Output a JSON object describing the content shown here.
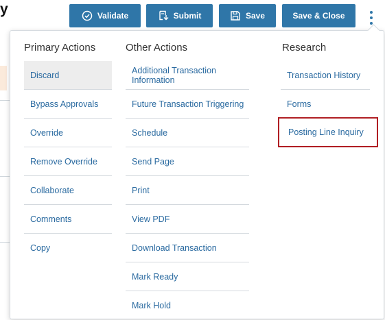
{
  "background": {
    "title_fragment": "y"
  },
  "toolbar": {
    "validate_label": "Validate",
    "submit_label": "Submit",
    "save_label": "Save",
    "save_close_label": "Save & Close",
    "accent_color": "#2f76a8"
  },
  "menu": {
    "primary": {
      "heading": "Primary Actions",
      "items": [
        "Discard",
        "Bypass Approvals",
        "Override",
        "Remove Override",
        "Collaborate",
        "Comments",
        "Copy"
      ]
    },
    "other": {
      "heading": "Other Actions",
      "items": [
        "Additional Transaction Information",
        "Future Transaction Triggering",
        "Schedule",
        "Send Page",
        "Print",
        "View PDF",
        "Download Transaction",
        "Mark Ready",
        "Mark Hold"
      ]
    },
    "research": {
      "heading": "Research",
      "items": [
        "Transaction History",
        "Forms",
        "Posting Line Inquiry"
      ]
    },
    "link_color": "#2a6aa0",
    "highlight_color": "#b01e23"
  }
}
